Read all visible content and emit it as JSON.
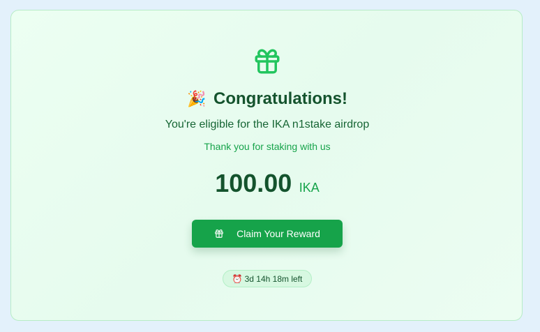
{
  "colors": {
    "accent": "#16a34a",
    "dark_green": "#14532d",
    "card_border": "#b7ecc6",
    "page_background": "#e3f1fb"
  },
  "icons": {
    "hero": "gift-icon",
    "button": "gift-icon",
    "title_emoji": "party-popper-icon",
    "timer": "alarm-clock-icon"
  },
  "reward": {
    "title_emoji": "🎉",
    "title": "Congratulations!",
    "subtitle": "You're eligible for the IKA n1stake airdrop",
    "thanks": "Thank you for staking with us",
    "amount": "100.00",
    "unit": "IKA",
    "claim_label": "Claim Your Reward",
    "timer_emoji": "⏰",
    "time_left": "3d 14h 18m left"
  }
}
